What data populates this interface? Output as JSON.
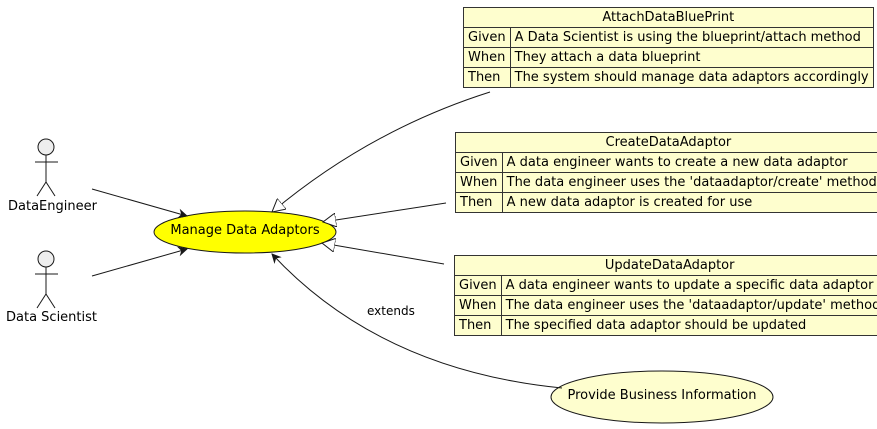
{
  "actors": [
    {
      "id": "data-engineer",
      "label": "DataEngineer"
    },
    {
      "id": "data-scientist",
      "label": "Data Scientist"
    }
  ],
  "usecases": {
    "main": "Manage Data Adaptors",
    "extension": "Provide Business Information"
  },
  "edge_labels": {
    "extends": "extends"
  },
  "notes": [
    {
      "title": "AttachDataBluePrint",
      "rows": [
        {
          "key": "Given",
          "value": "A Data Scientist is using the blueprint/attach method"
        },
        {
          "key": "When",
          "value": "They attach a data blueprint"
        },
        {
          "key": "Then",
          "value": "The system should manage data adaptors accordingly"
        }
      ]
    },
    {
      "title": "CreateDataAdaptor",
      "rows": [
        {
          "key": "Given",
          "value": "A data engineer wants to create a new data adaptor"
        },
        {
          "key": "When",
          "value": "The data engineer uses the 'dataadaptor/create' method"
        },
        {
          "key": "Then",
          "value": "A new data adaptor is created for use"
        }
      ]
    },
    {
      "title": "UpdateDataAdaptor",
      "rows": [
        {
          "key": "Given",
          "value": "A data engineer wants to update a specific data adaptor"
        },
        {
          "key": "When",
          "value": "The data engineer uses the 'dataadaptor/update' method"
        },
        {
          "key": "Then",
          "value": "The specified data adaptor should be updated"
        }
      ]
    }
  ],
  "colors": {
    "main_usecase_fill": "#ffff00",
    "usecase_fill": "#fefece",
    "actor_fill": "#eeeeee",
    "stroke": "#333333"
  }
}
